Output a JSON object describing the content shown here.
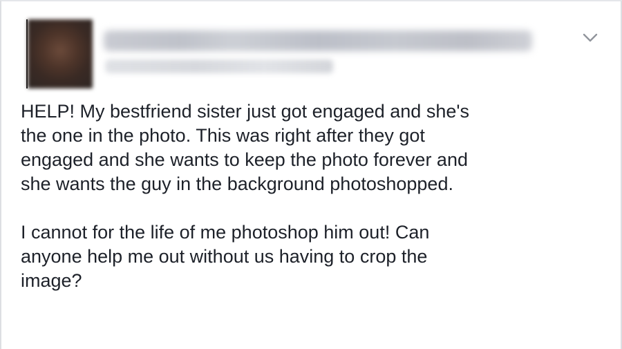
{
  "post": {
    "author_name": "",
    "timestamp": "",
    "icons": {
      "menu": "chevron-down-icon"
    },
    "paragraphs": [
      "HELP! My bestfriend sister just got engaged and she's\nthe one in the photo. This was right after they got\nengaged and she wants to keep the photo forever and\nshe wants the guy in the background photoshopped.",
      "I cannot for the life of me photoshop him out! Can\nanyone help me out without us having to crop the\nimage?"
    ]
  },
  "colors": {
    "text": "#1d2129",
    "border": "#dddfe2",
    "chevron": "#90949c"
  }
}
